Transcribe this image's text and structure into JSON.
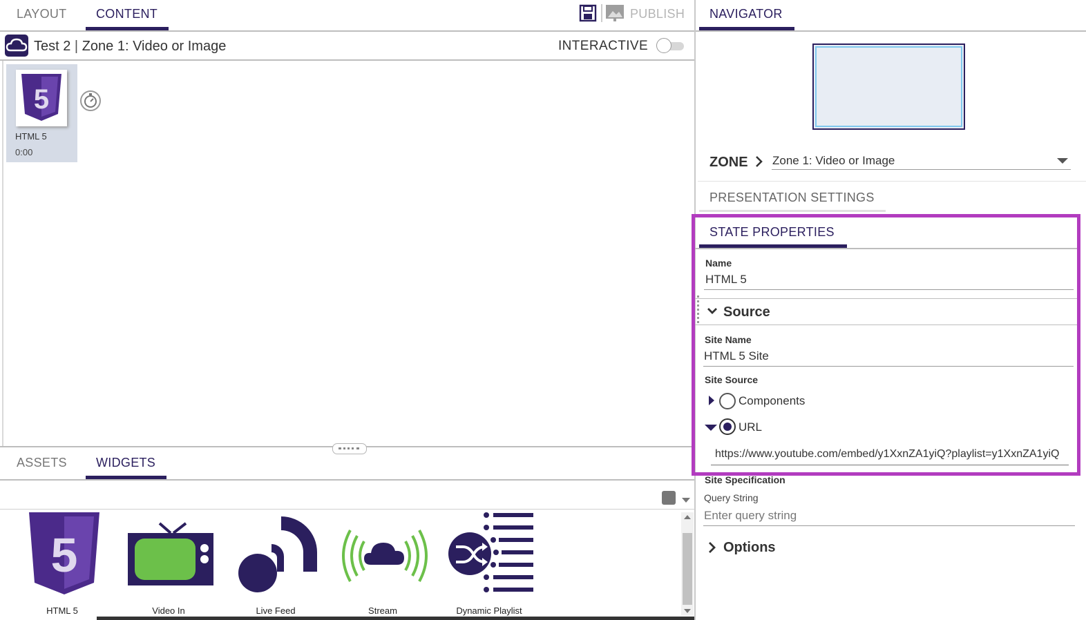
{
  "left_tabs": {
    "layout": "LAYOUT",
    "content": "CONTENT"
  },
  "toolbar": {
    "save_icon": "save-icon",
    "publish_icon": "publish-icon",
    "publish": "PUBLISH"
  },
  "zone_bar": {
    "cloud_icon": "cloud-icon",
    "presentation": "Test 2",
    "separator": "|",
    "zone": "Zone 1: Video or Image",
    "interactive": "INTERACTIVE"
  },
  "timeline": {
    "item": {
      "name": "HTML 5",
      "duration": "0:00",
      "icon": "html5-icon"
    },
    "timer_icon": "stopwatch-icon"
  },
  "bottom_tabs": {
    "assets": "ASSETS",
    "widgets": "WIDGETS"
  },
  "widgets": [
    {
      "label": "HTML 5",
      "icon": "html5-icon"
    },
    {
      "label": "Video In",
      "icon": "tv-icon"
    },
    {
      "label": "Live Feed",
      "icon": "rss-feed-icon"
    },
    {
      "label": "Stream",
      "icon": "stream-cloud-icon"
    },
    {
      "label": "Dynamic Playlist",
      "icon": "shuffle-list-icon"
    }
  ],
  "navigator": {
    "tab": "NAVIGATOR",
    "zone_label": "ZONE",
    "zone_value": "Zone 1: Video or Image",
    "presentation_settings": "PRESENTATION SETTINGS"
  },
  "state_properties": {
    "tab": "STATE PROPERTIES",
    "name_label": "Name",
    "name_value": "HTML 5",
    "source_header": "Source",
    "site_name_label": "Site Name",
    "site_name_value": "HTML 5 Site",
    "site_source_label": "Site Source",
    "option_components": "Components",
    "option_url": "URL",
    "url_value": "https://www.youtube.com/embed/y1XxnZA1yiQ?playlist=y1XxnZA1yiQ",
    "site_spec_label": "Site Specification",
    "query_label": "Query String",
    "query_placeholder": "Enter query string",
    "options_header": "Options"
  },
  "colors": {
    "accent": "#2b1f5e",
    "highlight": "#b23cbf",
    "green": "#6cc04a"
  }
}
